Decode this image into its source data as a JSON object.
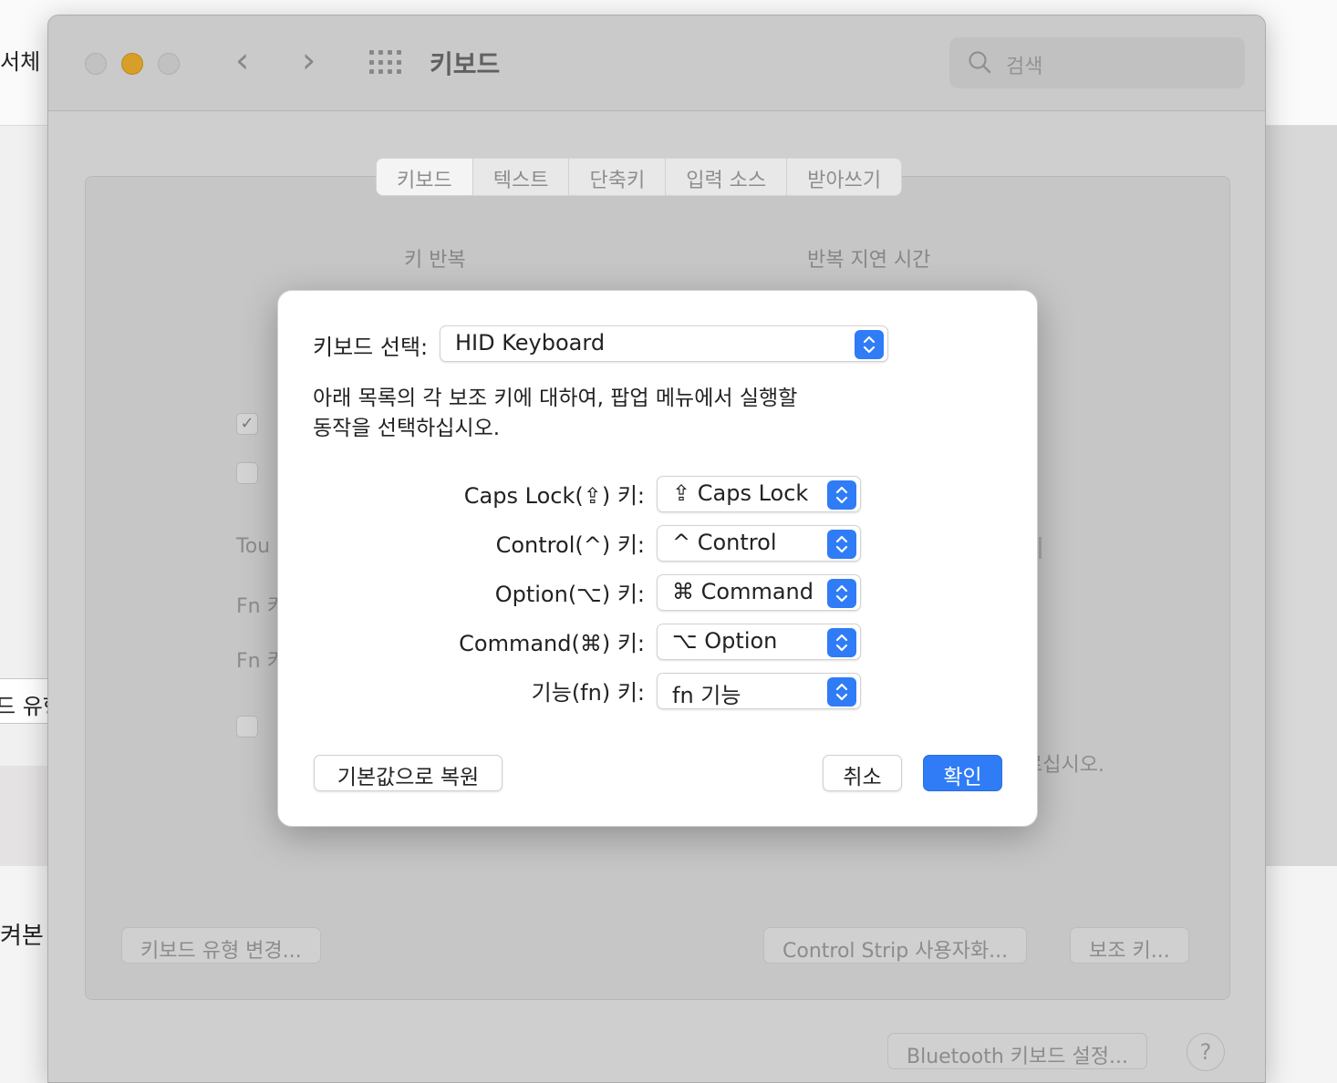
{
  "background": {
    "left_text_top": "서체 ",
    "left_button_text": "드 유형",
    "left_text_bottom": "켜본"
  },
  "window": {
    "title": "키보드",
    "search_placeholder": "검색",
    "tabs": [
      {
        "label": "키보드",
        "active": true
      },
      {
        "label": "텍스트",
        "active": false
      },
      {
        "label": "단축키",
        "active": false
      },
      {
        "label": "입력 소스",
        "active": false
      },
      {
        "label": "받아쓰기",
        "active": false
      }
    ],
    "key_repeat_label": "키 반복",
    "repeat_delay_label": "반복 지연 시간",
    "partial_labels": [
      "Tou",
      "Fn 키",
      "Fn 키"
    ],
    "partial_right_text": "르십시오.",
    "buttons": {
      "change_keyboard_type": "키보드 유형 변경...",
      "control_strip": "Control Strip 사용자화...",
      "modifier_keys": "보조 키...",
      "bluetooth": "Bluetooth 키보드 설정...",
      "help": "?"
    }
  },
  "sheet": {
    "keyboard_select_label": "키보드 선택:",
    "keyboard_select_value": "HID Keyboard",
    "instructions": "아래 목록의 각 보조 키에 대하여, 팝업 메뉴에서 실행할 동작을 선택하십시오.",
    "instructions_line1": "아래 목록의 각 보조 키에 대하여, 팝업 메뉴에서 실행할",
    "instructions_line2": "동작을 선택하십시오.",
    "rows": [
      {
        "label": "Caps Lock(⇪) 키:",
        "value": "⇪ Caps Lock"
      },
      {
        "label": "Control(^) 키:",
        "value": "^ Control"
      },
      {
        "label": "Option(⌥) 키:",
        "value": "⌘ Command"
      },
      {
        "label": "Command(⌘) 키:",
        "value": "⌥ Option"
      },
      {
        "label": "기능(fn) 키:",
        "value": "fn 기능"
      }
    ],
    "restore_defaults": "기본값으로 복원",
    "cancel": "취소",
    "ok": "확인"
  },
  "colors": {
    "accent": "#2f7cf6",
    "minimize": "#f5b530"
  }
}
